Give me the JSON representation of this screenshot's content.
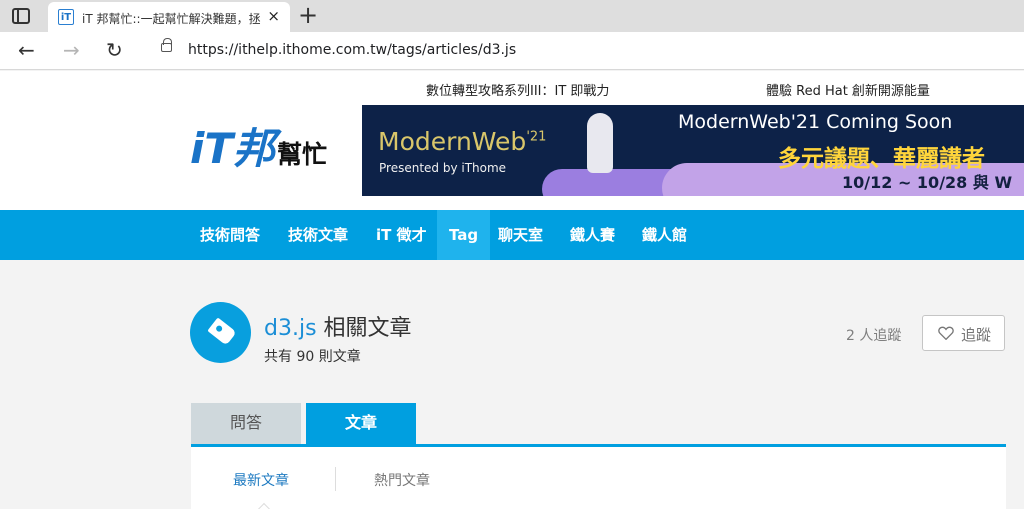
{
  "browser": {
    "tab_title": "iT 邦幫忙::一起幫忙解決難題，拯",
    "url": "https://ithelp.ithome.com.tw/tags/articles/d3.js"
  },
  "header": {
    "ads": [
      "數位轉型攻略系列III：IT 即戰力",
      "體驗 Red Hat 創新開源能量"
    ],
    "logo": {
      "main": "iT邦",
      "sub": "幫忙"
    },
    "banner": {
      "brand": "ModernWeb",
      "brand_year": "'21",
      "presented_by": "Presented by iThome",
      "headline": "ModernWeb'21 Coming Soon",
      "subline": "多元議題、華麗講者",
      "dates": "10/12 ~ 10/28 與 W"
    }
  },
  "nav": {
    "items": [
      "技術問答",
      "技術文章",
      "iT 徵才",
      "Tag",
      "聊天室",
      "鐵人賽",
      "鐵人館"
    ],
    "active": "Tag"
  },
  "tag_page": {
    "tag_name": "d3.js",
    "title_suffix": "相關文章",
    "article_count": "共有 90 則文章",
    "follower_count": "2 人追蹤",
    "follow_label": "追蹤"
  },
  "tabs": [
    "問答",
    "文章"
  ],
  "sort": [
    "最新文章",
    "熱門文章"
  ],
  "colors": {
    "primary": "#009fe0",
    "link": "#1b8ed6"
  },
  "icons": [
    "sidebar-toggle-icon",
    "favicon-icon",
    "close-icon",
    "plus-icon",
    "back-arrow-icon",
    "forward-arrow-icon",
    "reload-icon",
    "lock-icon",
    "tag-icon",
    "heart-icon"
  ]
}
